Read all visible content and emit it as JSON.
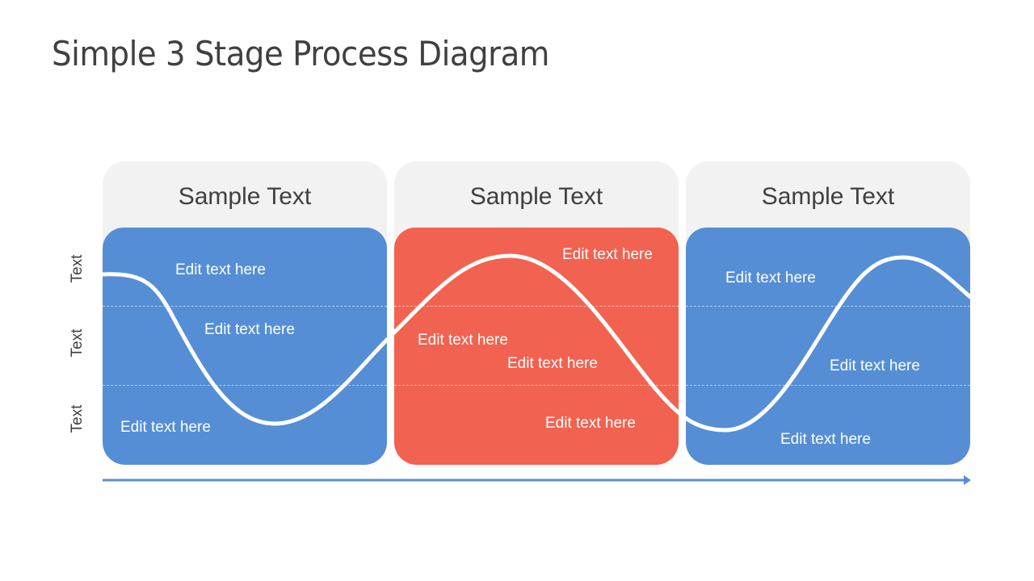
{
  "title": "Simple 3 Stage Process Diagram",
  "colors": {
    "blue": "#558ed5",
    "red": "#f26250",
    "header_bg": "#f2f2f2",
    "text_dark": "#404040",
    "arrow": "#558ed5"
  },
  "y_axis_labels": [
    "Text",
    "Text",
    "Text"
  ],
  "stages": [
    {
      "header": "Sample Text",
      "color": "#558ed5",
      "labels": [
        "Edit text here",
        "Edit text here",
        "Edit text here"
      ]
    },
    {
      "header": "Sample Text",
      "color": "#f26250",
      "labels": [
        "Edit text here",
        "Edit text here",
        "Edit text here",
        "Edit text here"
      ]
    },
    {
      "header": "Sample Text",
      "color": "#558ed5",
      "labels": [
        "Edit text here",
        "Edit text here",
        "Edit text here"
      ]
    }
  ],
  "arrow": {
    "direction": "right",
    "icon": "arrow-right-icon"
  }
}
